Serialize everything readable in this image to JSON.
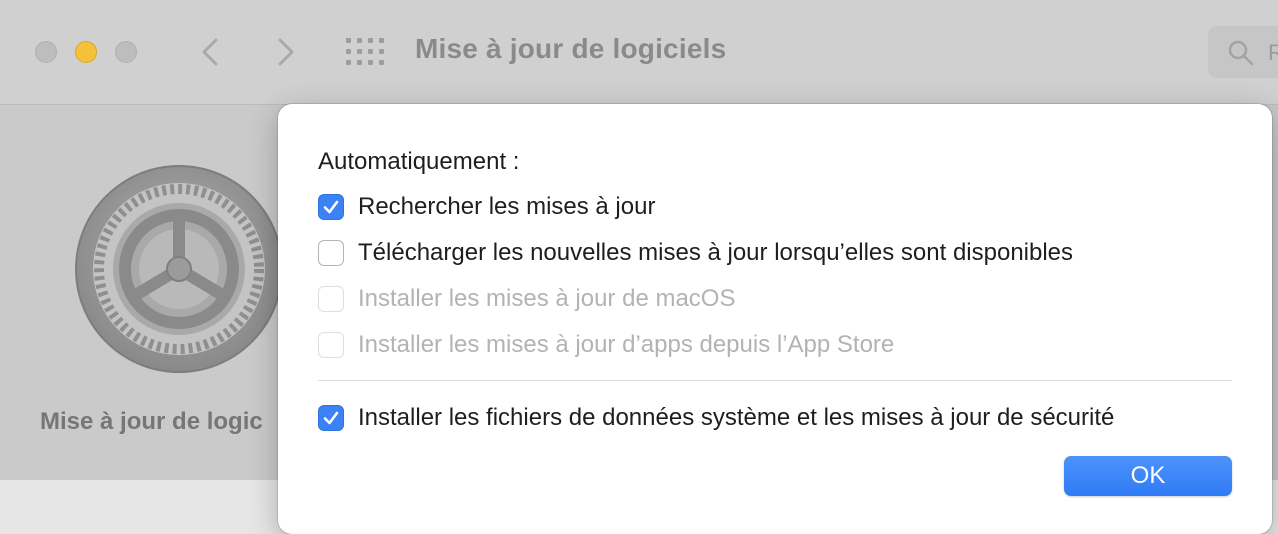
{
  "window": {
    "title": "Mise à jour de logiciels",
    "search_placeholder": "R",
    "sidebar_label": "Mise à jour de logic"
  },
  "dialog": {
    "heading": "Automatiquement :",
    "options": [
      {
        "label": "Rechercher les mises à jour",
        "checked": true,
        "enabled": true
      },
      {
        "label": "Télécharger les nouvelles mises à jour lorsqu’elles sont disponibles",
        "checked": false,
        "enabled": true
      },
      {
        "label": "Installer les mises à jour de macOS",
        "checked": false,
        "enabled": false
      },
      {
        "label": "Installer les mises à jour d’apps depuis l’App Store",
        "checked": false,
        "enabled": false
      },
      {
        "label": "Installer les fichiers de données système et les mises à jour de sécurité",
        "checked": true,
        "enabled": true
      }
    ],
    "ok_label": "OK"
  },
  "colors": {
    "accent": "#3b82f6",
    "minimize": "#f3c13a"
  },
  "icons": [
    "close-dot",
    "minimize-dot",
    "zoom-dot",
    "back-chevron-icon",
    "forward-chevron-icon",
    "grid-icon",
    "search-icon",
    "gear-icon",
    "checkmark-icon"
  ]
}
